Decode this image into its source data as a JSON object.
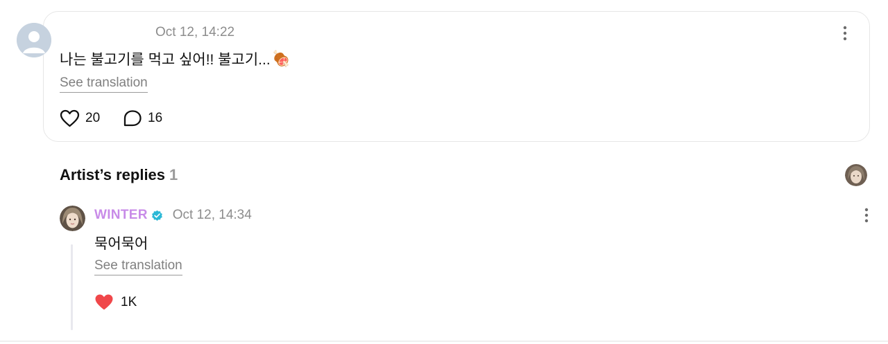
{
  "post": {
    "timestamp": "Oct 12, 14:22",
    "text": "나는 불고기를 먹고 싶어!! 불고기...",
    "food_emoji": "🍖",
    "see_translation": "See translation",
    "likes": "20",
    "comments": "16"
  },
  "artist_replies": {
    "title": "Artist’s replies",
    "count": "1",
    "reply": {
      "author": "WINTER",
      "timestamp": "Oct 12, 14:34",
      "text": "묵어묵어",
      "see_translation": "See translation",
      "likes": "1K"
    }
  },
  "colors": {
    "author_name": "#c88be8",
    "verified_badge": "#2bb8d6",
    "liked_heart": "#f0474a",
    "muted_text": "#8c8c8c"
  },
  "icons": {
    "more": "vertical-ellipsis",
    "like": "heart-outline",
    "liked": "heart-filled",
    "comment": "speech-bubble",
    "verified": "verified-badge"
  }
}
